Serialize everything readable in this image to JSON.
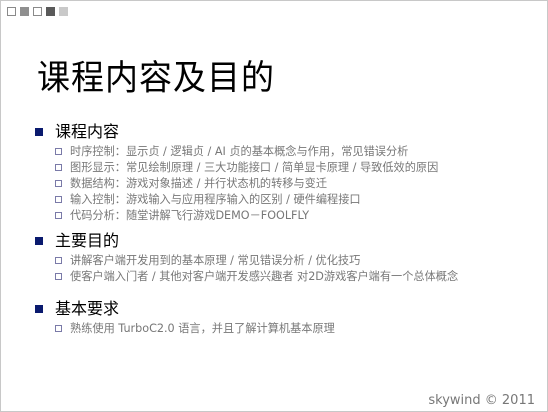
{
  "slide": {
    "title": "课程内容及目的",
    "sections": [
      {
        "title": "课程内容",
        "items": [
          "时序控制：显示贞 / 逻辑贞 / AI 贞的基本概念与作用，常见错误分析",
          "图形显示：常见绘制原理 / 三大功能接口 / 简单显卡原理 / 导致低效的原因",
          "数据结构：游戏对象描述 / 并行状态机的转移与变迁",
          "输入控制：游戏输入与应用程序输入的区别 / 硬件编程接口",
          "代码分析：随堂讲解飞行游戏DEMO－FOOLFLY"
        ]
      },
      {
        "title": "主要目的",
        "items": [
          "讲解客户端开发用到的基本原理 / 常见错误分析 / 优化技巧",
          "使客户端入门者 / 其他对客户端开发感兴趣者 对2D游戏客户端有一个总体概念"
        ]
      },
      {
        "title": "基本要求",
        "items": [
          "熟练使用 TurboC2.0 语言，并且了解计算机基本原理"
        ]
      }
    ],
    "footer": "skywind © 2011"
  },
  "colors": {
    "main_bullet": "#0a1a6e",
    "sub_text": "#777777",
    "sub_bullet_border": "#7a7aa8"
  }
}
